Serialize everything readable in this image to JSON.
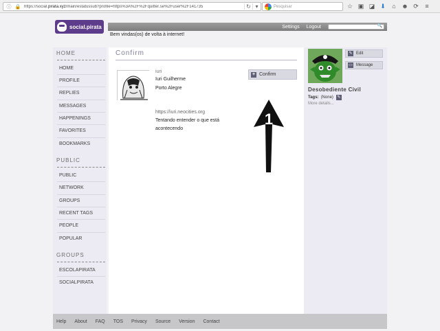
{
  "browser": {
    "url_prefix": "https://social.",
    "url_host": "pirata.xyz",
    "url_rest": "/main/estatussub?profile=https%3A%2F%2Fquitter.se%2Fuser%2F141735",
    "search_placeholder": "Pesquisar"
  },
  "header": {
    "logo_text": "social.pirata",
    "settings_label": "Settings",
    "logout_label": "Logout",
    "welcome": "Bem vindas(os) de volta à internet!"
  },
  "sidebar": {
    "home_heading": "HOME",
    "home_items": [
      "HOME",
      "PROFILE",
      "REPLIES",
      "MESSAGES",
      "HAPPENINGS",
      "FAVORITES",
      "BOOKMARKS"
    ],
    "public_heading": "PUBLIC",
    "public_items": [
      "PUBLIC",
      "NETWORK",
      "GROUPS",
      "RECENT TAGS",
      "PEOPLE",
      "POPULAR"
    ],
    "groups_heading": "GROUPS",
    "group_items": [
      "ESCOLAPIRATA",
      "SOCIALPIRATA"
    ]
  },
  "main": {
    "title": "Confirm",
    "profile": {
      "nickname": "iuri",
      "fullname": "Iuri Guilherme",
      "location": "Porto Alegre",
      "homepage": "https://iuri.neocities.org",
      "bio_line1": "Tentando entender o que está",
      "bio_line2": "acontecendo"
    },
    "confirm_label": "Confirm",
    "annotation_number": "1"
  },
  "right": {
    "edit_label": "Edit",
    "message_label": "Message",
    "name": "Desobediente Civil",
    "tags_label": "Tags:",
    "tags_value": "(None)",
    "more_details": "More details..."
  },
  "footer": {
    "links": [
      "Help",
      "About",
      "FAQ",
      "TOS",
      "Privacy",
      "Source",
      "Version",
      "Contact"
    ]
  },
  "colors": {
    "brand": "#5e3c8c",
    "annotation": "#000000"
  }
}
